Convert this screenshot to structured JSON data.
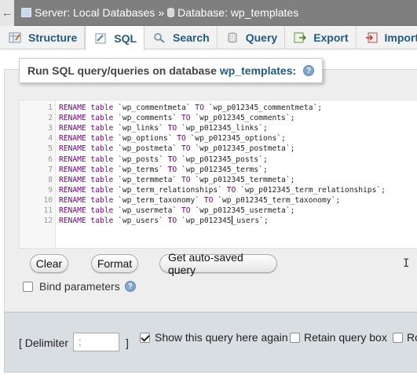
{
  "breadcrumb": {
    "back": "←",
    "server": "Server: Local Databases",
    "separator": "»",
    "database": "Database: wp_templates"
  },
  "tabs": [
    {
      "label": "Structure",
      "icon": "structure-icon"
    },
    {
      "label": "SQL",
      "icon": "sql-icon",
      "active": true
    },
    {
      "label": "Search",
      "icon": "search-icon"
    },
    {
      "label": "Query",
      "icon": "query-icon"
    },
    {
      "label": "Export",
      "icon": "export-icon"
    },
    {
      "label": "Import",
      "icon": "import-icon"
    }
  ],
  "query_box": {
    "legend_prefix": "Run SQL query/queries on database",
    "legend_db": "wp_templates:",
    "help": "?"
  },
  "editor": {
    "lines": [
      {
        "n": "1",
        "kw": "RENAME table",
        "src": "`wp_commentmeta`",
        "to": "TO",
        "dst": "`wp_p012345_commentmeta`;"
      },
      {
        "n": "2",
        "kw": "RENAME table",
        "src": "`wp_comments`",
        "to": "TO",
        "dst": "`wp_p012345_comments`;"
      },
      {
        "n": "3",
        "kw": "RENAME table",
        "src": "`wp_links`",
        "to": "TO",
        "dst": "`wp_p012345_links`;"
      },
      {
        "n": "4",
        "kw": "RENAME table",
        "src": "`wp_options`",
        "to": "TO",
        "dst": "`wp_p012345_options`;"
      },
      {
        "n": "5",
        "kw": "RENAME table",
        "src": "`wp_postmeta`",
        "to": "TO",
        "dst": "`wp_p012345_postmeta`;"
      },
      {
        "n": "6",
        "kw": "RENAME table",
        "src": "`wp_posts`",
        "to": "TO",
        "dst": "`wp_p012345_posts`;"
      },
      {
        "n": "7",
        "kw": "RENAME table",
        "src": "`wp_terms`",
        "to": "TO",
        "dst": "`wp_p012345_terms`;"
      },
      {
        "n": "8",
        "kw": "RENAME table",
        "src": "`wp_termmeta`",
        "to": "TO",
        "dst": "`wp_p012345_termmeta`;"
      },
      {
        "n": "9",
        "kw": "RENAME table",
        "src": "`wp_term_relationships`",
        "to": "TO",
        "dst": "`wp_p012345_term_relationships`;"
      },
      {
        "n": "10",
        "kw": "RENAME table",
        "src": "`wp_term_taxonomy`",
        "to": "TO",
        "dst": "`wp_p012345_term_taxonomy`;"
      },
      {
        "n": "11",
        "kw": "RENAME table",
        "src": "`wp_usermeta`",
        "to": "TO",
        "dst": "`wp_p012345_usermeta`;"
      },
      {
        "n": "12",
        "kw": "RENAME table",
        "src": "`wp_users`",
        "to": "TO",
        "dst_a": "`wp_p012345",
        "dst_b": "_users`;"
      }
    ]
  },
  "buttons": {
    "clear": "Clear",
    "format": "Format",
    "auto_saved": "Get auto-saved query"
  },
  "bind_parameters": {
    "label": "Bind parameters",
    "checked": false
  },
  "options": {
    "delimiter_label_open": "[ Delimiter",
    "delimiter_value": ";",
    "delimiter_close": "]",
    "show_query_label": "Show this query here again",
    "show_query_checked": true,
    "retain_box_label": "Retain query box",
    "retain_box_checked": false,
    "truncated_label": "Ro"
  },
  "colors": {
    "link_blue": "#235a81",
    "keyword_purple": "#770088",
    "breadcrumb_bg": "#7f7f7f"
  }
}
